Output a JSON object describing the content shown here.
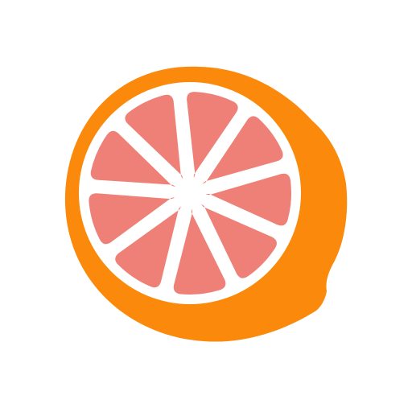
{
  "logo": {
    "icon": "grapefruit-slice-icon",
    "colors": {
      "background": "#ffffff",
      "peel": "#fb8a0c",
      "pith": "#ffffff",
      "segment": "#ef8077"
    },
    "segment_count": 9
  }
}
